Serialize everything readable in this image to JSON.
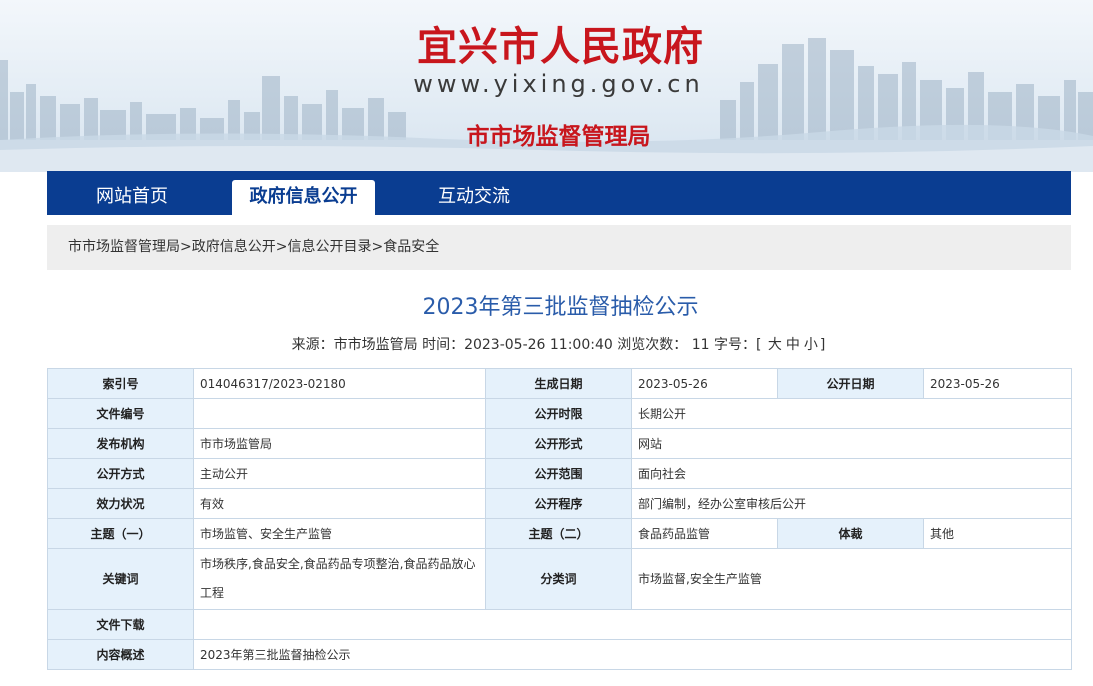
{
  "header": {
    "site_title": "宜兴市人民政府",
    "site_url": "www.yixing.gov.cn",
    "department": "市市场监督管理局"
  },
  "nav": {
    "items": [
      {
        "label": "网站首页",
        "active": false
      },
      {
        "label": "政府信息公开",
        "active": true
      },
      {
        "label": "互动交流",
        "active": false
      }
    ]
  },
  "breadcrumb": {
    "items": [
      "市市场监督管理局",
      "政府信息公开",
      "信息公开目录",
      "食品安全"
    ],
    "separator": ">"
  },
  "article": {
    "title": "2023年第三批监督抽检公示",
    "source_label": "来源：",
    "source": "市市场监管局",
    "time_label": "时间：",
    "time": "2023-05-26 11:00:40",
    "views_label": "浏览次数：",
    "views": "11",
    "fontsize_label": "字号：",
    "fontsize_open": "[",
    "fontsize_large": "大",
    "fontsize_medium": "中",
    "fontsize_small": "小",
    "fontsize_close": "]"
  },
  "info_table": {
    "index_no_label": "索引号",
    "index_no": "014046317/2023-02180",
    "gen_date_label": "生成日期",
    "gen_date": "2023-05-26",
    "pub_date_label": "公开日期",
    "pub_date": "2023-05-26",
    "doc_no_label": "文件编号",
    "doc_no": "",
    "time_limit_label": "公开时限",
    "time_limit": "长期公开",
    "publisher_label": "发布机构",
    "publisher": "市市场监管局",
    "form_label": "公开形式",
    "form": "网站",
    "method_label": "公开方式",
    "method": "主动公开",
    "scope_label": "公开范围",
    "scope": "面向社会",
    "status_label": "效力状况",
    "status": "有效",
    "procedure_label": "公开程序",
    "procedure": "部门编制，经办公室审核后公开",
    "topic1_label": "主题（一）",
    "topic1": "市场监管、安全生产监管",
    "topic2_label": "主题（二）",
    "topic2": "食品药品监管",
    "genre_label": "体裁",
    "genre": "其他",
    "keywords_label": "关键词",
    "keywords": "市场秩序,食品安全,食品药品专项整治,食品药品放心工程",
    "category_label": "分类词",
    "category": "市场监督,安全生产监管",
    "download_label": "文件下载",
    "download": "",
    "summary_label": "内容概述",
    "summary": "2023年第三批监督抽检公示"
  },
  "colors": {
    "brand_red": "#c8161d",
    "nav_blue": "#0a3d91",
    "title_blue": "#2a5caa",
    "label_bg": "#e5f1fb",
    "border": "#c8d7e6",
    "breadcrumb_bg": "#eeeeee"
  }
}
